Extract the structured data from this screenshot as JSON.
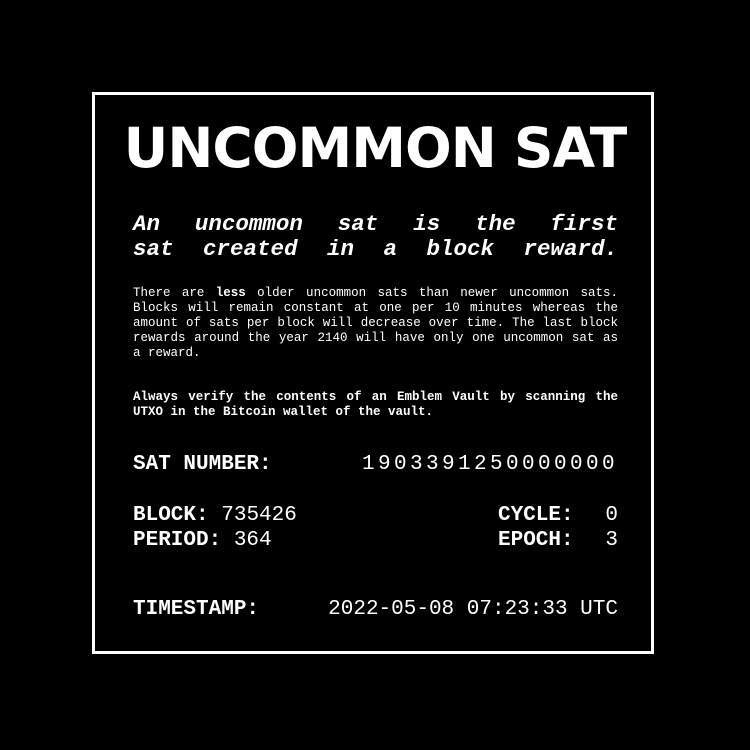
{
  "title": "UNCOMMON SAT",
  "subtitle": {
    "line1": "An uncommon sat is the first",
    "line2": "sat created in a block reward."
  },
  "description": {
    "pre": "There are ",
    "bold": "less",
    "post": " older uncommon sats than newer uncommon sats. Blocks will remain constant at one per 10 minutes whereas the amount of sats per block will decrease over time. The last block rewards around the year 2140 will have only one uncommon sat as a reward."
  },
  "warning": "Always verify the contents of an Emblem Vault by scanning the UTXO in the Bitcoin wallet of the vault.",
  "sat_number": {
    "label": "SAT NUMBER:",
    "value": "1903391250000000"
  },
  "block": {
    "label": "BLOCK:",
    "value": "735426"
  },
  "cycle": {
    "label": "CYCLE:",
    "value": "0"
  },
  "period": {
    "label": "PERIOD:",
    "value": "364"
  },
  "epoch": {
    "label": "EPOCH:",
    "value": "3"
  },
  "timestamp": {
    "label": "TIMESTAMP:",
    "value": "2022-05-08 07:23:33 UTC"
  },
  "colors": {
    "background": "#000000",
    "foreground": "#ffffff"
  }
}
